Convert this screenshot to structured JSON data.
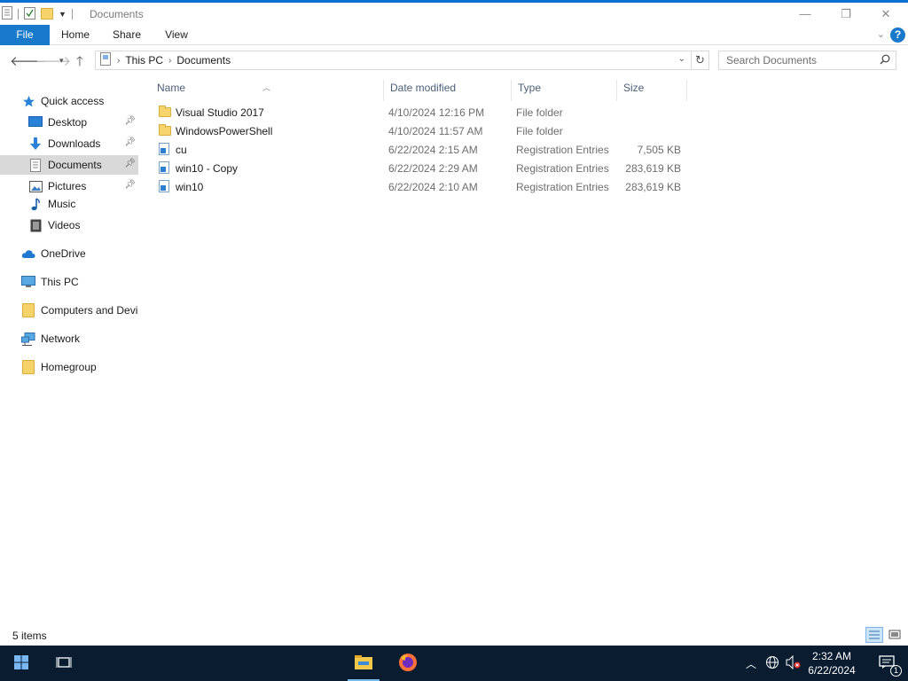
{
  "window": {
    "title": "Documents"
  },
  "ribbon": {
    "tabs": [
      {
        "label": "File"
      },
      {
        "label": "Home"
      },
      {
        "label": "Share"
      },
      {
        "label": "View"
      }
    ],
    "help_label": "?"
  },
  "address": {
    "breadcrumbs": [
      "This PC",
      "Documents"
    ]
  },
  "search": {
    "placeholder": "Search Documents"
  },
  "nav": {
    "items": [
      {
        "label": "Quick access",
        "icon": "star-icon"
      },
      {
        "label": "Desktop",
        "icon": "desktop-icon",
        "pinned": true
      },
      {
        "label": "Downloads",
        "icon": "download-arrow-icon",
        "pinned": true
      },
      {
        "label": "Documents",
        "icon": "documents-icon",
        "pinned": true,
        "selected": true
      },
      {
        "label": "Pictures",
        "icon": "pictures-icon",
        "pinned": true
      },
      {
        "label": "Music",
        "icon": "music-note-icon"
      },
      {
        "label": "Videos",
        "icon": "video-icon"
      },
      {
        "label": "OneDrive",
        "icon": "cloud-icon"
      },
      {
        "label": "This PC",
        "icon": "computer-icon"
      },
      {
        "label": "Computers and Devices",
        "icon": "folder-icon"
      },
      {
        "label": "Network",
        "icon": "network-icon"
      },
      {
        "label": "Homegroup",
        "icon": "folder-icon"
      }
    ]
  },
  "columns": {
    "name": "Name",
    "date": "Date modified",
    "type": "Type",
    "size": "Size"
  },
  "files": [
    {
      "name": "Visual Studio 2017",
      "date": "4/10/2024 12:16 PM",
      "type": "File folder",
      "size": "",
      "icon": "folder-icon"
    },
    {
      "name": "WindowsPowerShell",
      "date": "4/10/2024 11:57 AM",
      "type": "File folder",
      "size": "",
      "icon": "folder-icon"
    },
    {
      "name": "cu",
      "date": "6/22/2024 2:15 AM",
      "type": "Registration Entries",
      "size": "7,505 KB",
      "icon": "registry-file-icon"
    },
    {
      "name": "win10 - Copy",
      "date": "6/22/2024 2:29 AM",
      "type": "Registration Entries",
      "size": "283,619 KB",
      "icon": "registry-file-icon"
    },
    {
      "name": "win10",
      "date": "6/22/2024 2:10 AM",
      "type": "Registration Entries",
      "size": "283,619 KB",
      "icon": "registry-file-icon"
    }
  ],
  "status": {
    "item_count": "5 items"
  },
  "taskbar": {
    "time": "2:32 AM",
    "date": "6/22/2024",
    "notification_count": "1"
  },
  "colors": {
    "accent": "#1979ca",
    "taskbar": "#0a1c30",
    "selected_nav": "#d9d9d9"
  }
}
